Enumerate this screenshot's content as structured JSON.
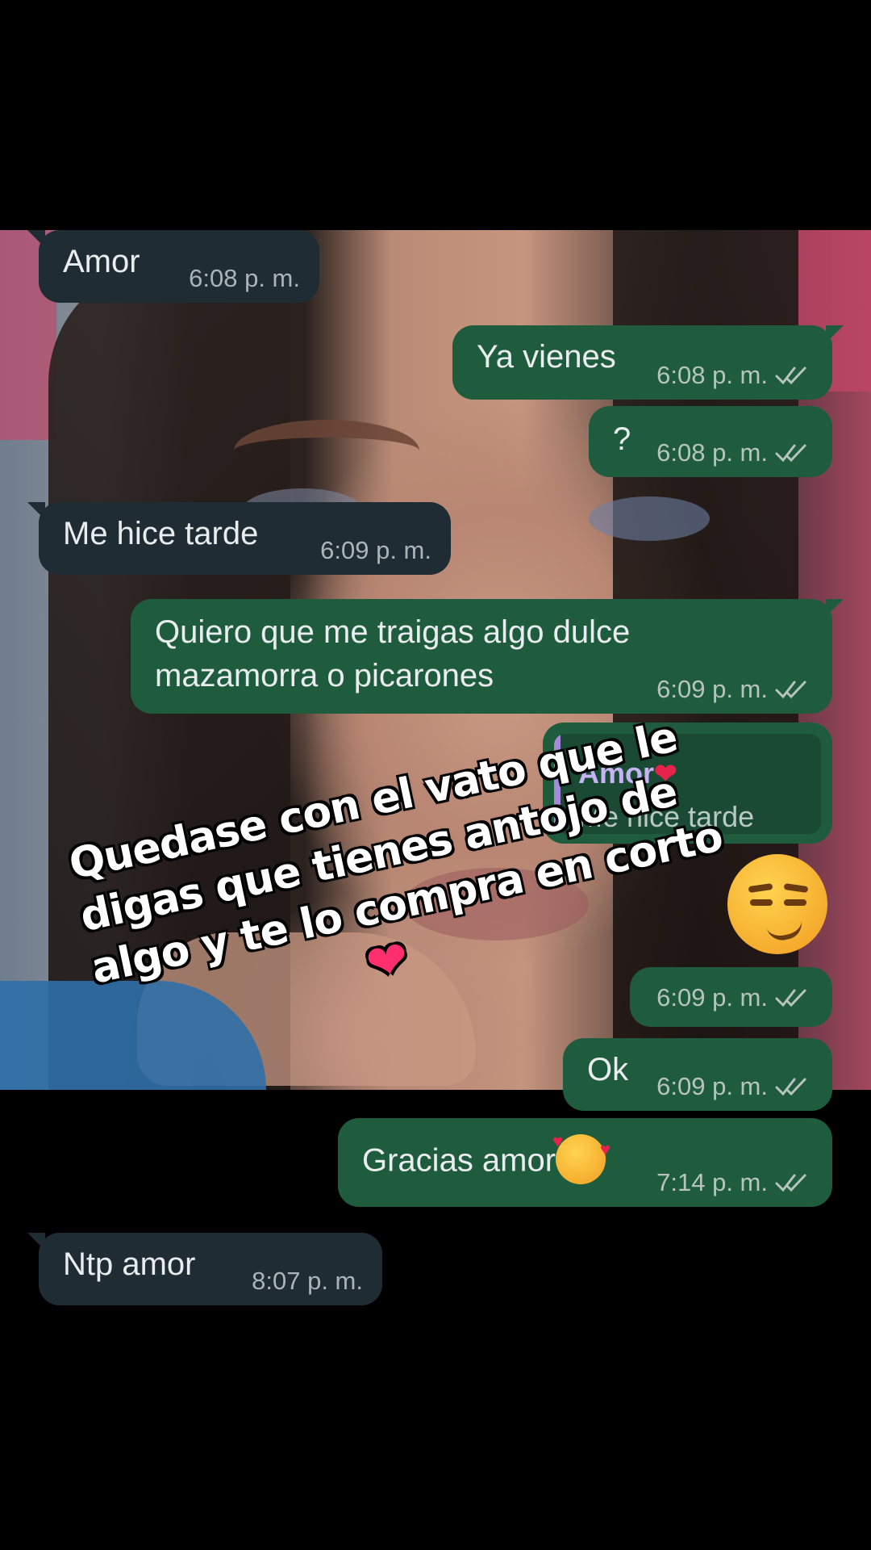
{
  "messages": [
    {
      "dir": "in",
      "text": "Amor",
      "time": "6:08 p. m."
    },
    {
      "dir": "out",
      "text": "Ya vienes",
      "time": "6:08 p. m."
    },
    {
      "dir": "out",
      "text": "?",
      "time": "6:08 p. m."
    },
    {
      "dir": "in",
      "text": "Me hice tarde",
      "time": "6:09 p. m."
    },
    {
      "dir": "out",
      "text_line1": "Quiero que me traigas algo dulce",
      "text_line2": "mazamorra o picarones",
      "time": "6:09 p. m."
    },
    {
      "dir": "out",
      "reply_name": "Amor",
      "reply_text": "Me hice tarde",
      "emoji": "smirking-face-emoji",
      "time": "6:09 p. m."
    },
    {
      "dir": "out",
      "text": "Ok",
      "time": "6:09 p. m."
    },
    {
      "dir": "out",
      "text": "Gracias amor",
      "emoji": "smiling-face-with-hearts-emoji",
      "time": "7:14 p. m."
    },
    {
      "dir": "in",
      "text": "Ntp amor",
      "time": "8:07 p. m."
    }
  ],
  "overlay": {
    "line1": "Quedase con el vato que le",
    "line2": "digas que tienes antojo de",
    "line3": "algo y te lo compra en corto",
    "heart": "❤"
  },
  "colors": {
    "incoming_bubble": "#1f2c33",
    "outgoing_bubble": "#1f5c3e",
    "reply_name": "#c7b3f3",
    "heart": "#ff2e6d"
  },
  "icons": [
    "double-check-icon",
    "red-heart-emoji",
    "smirking-face-emoji",
    "smiling-face-with-hearts-emoji"
  ]
}
